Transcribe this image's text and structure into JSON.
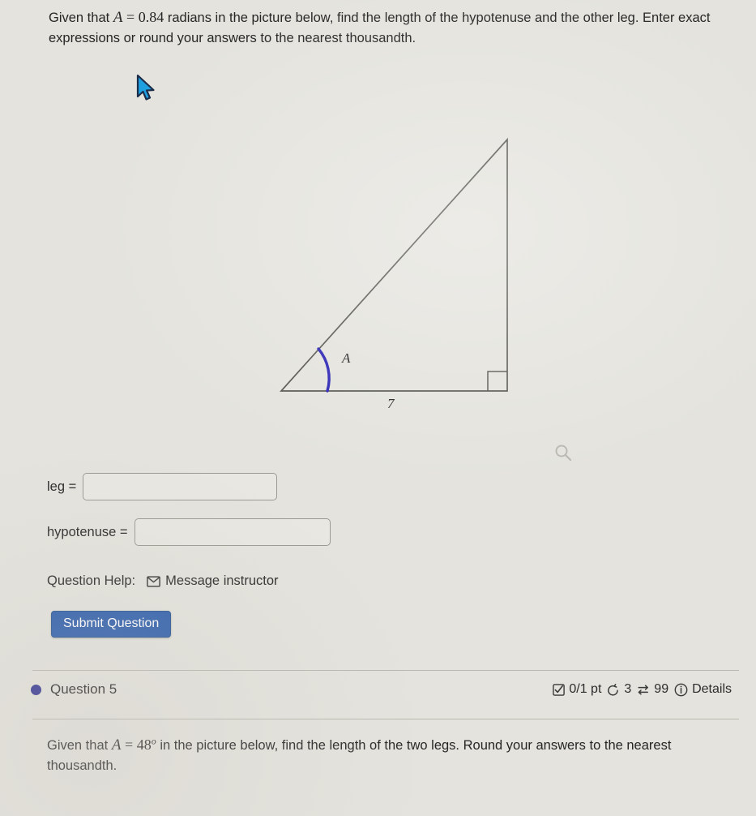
{
  "question_prompt": {
    "lead": "Given that",
    "variable": "A",
    "equals": "=",
    "value": "0.84",
    "unit_and_rest": "radians in the picture below, find the length of the hypotenuse and the other leg. Enter exact expressions or round your answers to the nearest thousandth."
  },
  "figure": {
    "type": "right-triangle",
    "angle_label": "A",
    "base_label": "7",
    "angle_arc_color": "#2a23b4",
    "line_color": "#4e4e4e",
    "right_angle_marker": true
  },
  "answers": {
    "leg": {
      "label": "leg =",
      "value": "",
      "placeholder": ""
    },
    "hypotenuse": {
      "label": "hypotenuse =",
      "value": "",
      "placeholder": ""
    }
  },
  "help": {
    "label": "Question Help:",
    "message_instructor": "Message instructor",
    "envelope_icon": "envelope-icon"
  },
  "submit": {
    "label": "Submit Question",
    "color": "#2b5cab"
  },
  "question_bar": {
    "title": "Question 5",
    "bullet_color": "#2c2f8f",
    "score": "0/1 pt",
    "attempts": "3",
    "views": "99",
    "details": "Details",
    "icons": {
      "score": "checkbox-icon",
      "attempts": "retry-arrow-icon",
      "views": "swap-arrows-icon",
      "details": "info-circle-icon"
    }
  },
  "next_question_prompt": {
    "lead": "Given that",
    "variable": "A",
    "equals": "=",
    "value": "48",
    "degree": "o",
    "rest": "in the picture below, find the length of the two legs. Round your answers to the nearest thousandth."
  },
  "cursor": {
    "icon": "mouse-pointer-icon",
    "color": "#1e9fe0"
  },
  "zoom_glyph": {
    "icon": "magnifier-icon"
  }
}
